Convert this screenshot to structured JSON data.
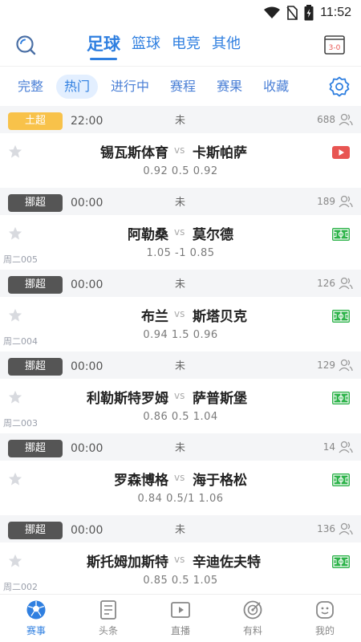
{
  "status_bar": {
    "time": "11:52"
  },
  "top_nav": {
    "sport_tabs": [
      "足球",
      "篮球",
      "电竞",
      "其他"
    ],
    "active_sport": 0,
    "score_icon_text": "3-0"
  },
  "filter_tabs": {
    "items": [
      "完整",
      "热门",
      "进行中",
      "赛程",
      "赛果",
      "收藏"
    ],
    "active": 1
  },
  "colors": {
    "accent": "#2f7fe0",
    "league_yellow": "#f8c24a",
    "league_gray": "#555555",
    "video_red": "#e85552",
    "pitch_green": "#2db34a"
  },
  "matches": [
    {
      "league": "土超",
      "league_color": "yellow",
      "time": "22:00",
      "status": "未",
      "views": "688",
      "home": "锡瓦斯体育",
      "away": "卡斯帕萨",
      "odds": "0.92  0.5  0.92",
      "code": "",
      "stream_icon": "video-icon"
    },
    {
      "league": "挪超",
      "league_color": "gray",
      "time": "00:00",
      "status": "未",
      "views": "189",
      "home": "阿勒桑",
      "away": "莫尔德",
      "odds": "1.05  -1  0.85",
      "code": "周二005",
      "stream_icon": "pitch-icon"
    },
    {
      "league": "挪超",
      "league_color": "gray",
      "time": "00:00",
      "status": "未",
      "views": "126",
      "home": "布兰",
      "away": "斯塔贝克",
      "odds": "0.94  1.5  0.96",
      "code": "周二004",
      "stream_icon": "pitch-icon"
    },
    {
      "league": "挪超",
      "league_color": "gray",
      "time": "00:00",
      "status": "未",
      "views": "129",
      "home": "利勒斯特罗姆",
      "away": "萨普斯堡",
      "odds": "0.86  0.5  1.04",
      "code": "周二003",
      "stream_icon": "pitch-icon"
    },
    {
      "league": "挪超",
      "league_color": "gray",
      "time": "00:00",
      "status": "未",
      "views": "14",
      "home": "罗森博格",
      "away": "海于格松",
      "odds": "0.84  0.5/1  1.06",
      "code": "",
      "stream_icon": "pitch-icon"
    },
    {
      "league": "挪超",
      "league_color": "gray",
      "time": "00:00",
      "status": "未",
      "views": "136",
      "home": "斯托姆加斯特",
      "away": "辛迪佐夫特",
      "odds": "0.85  0.5  1.05",
      "code": "周二002",
      "stream_icon": "pitch-icon"
    }
  ],
  "vs_text": "vs",
  "bottom_nav": {
    "items": [
      {
        "label": "赛事",
        "icon": "soccer-ball-icon"
      },
      {
        "label": "头条",
        "icon": "document-icon"
      },
      {
        "label": "直播",
        "icon": "play-icon"
      },
      {
        "label": "有料",
        "icon": "target-icon"
      },
      {
        "label": "我的",
        "icon": "profile-icon"
      }
    ],
    "active": 0
  }
}
